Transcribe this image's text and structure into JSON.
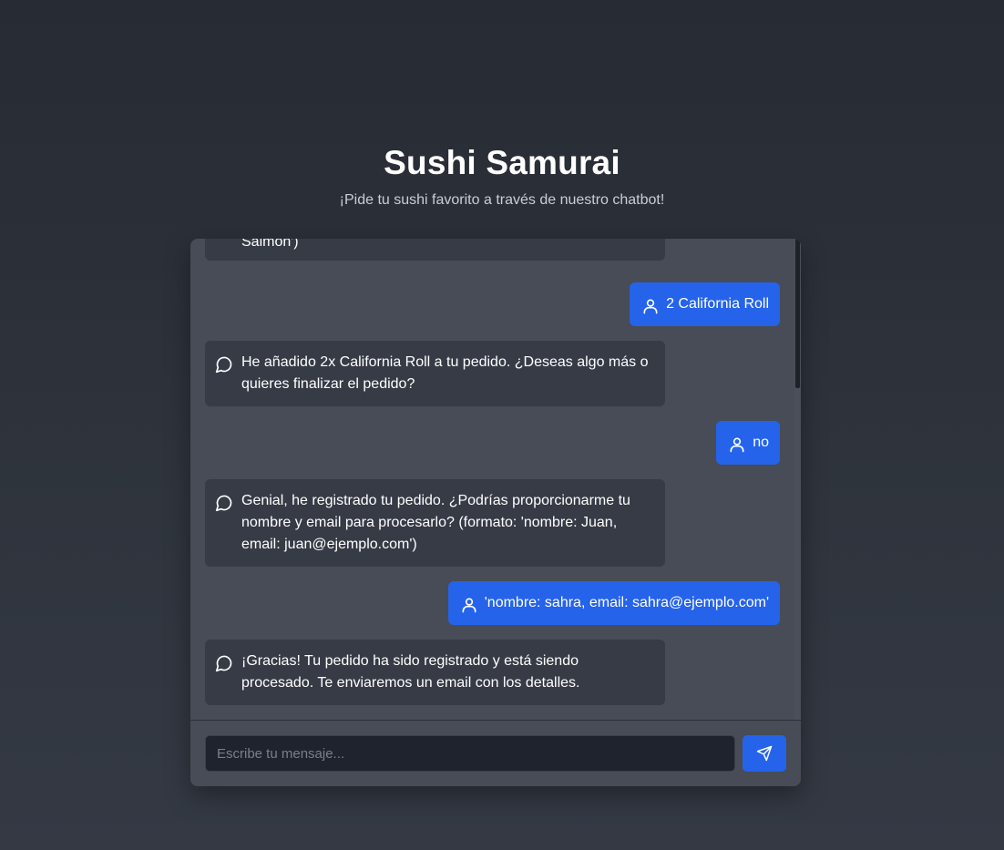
{
  "header": {
    "title": "Sushi Samurai",
    "subtitle": "¡Pide tu sushi favorito a través de nuestro chatbot!"
  },
  "colors": {
    "accent": "#2563eb",
    "bot_bubble": "#363b46",
    "chat_background": "#474c56",
    "page_background": "#2b2f37"
  },
  "messages": [
    {
      "role": "bot",
      "icon": "chat-bubble-icon",
      "text": "Salmón')"
    },
    {
      "role": "user",
      "icon": "user-icon",
      "text": "2 California Roll"
    },
    {
      "role": "bot",
      "icon": "chat-bubble-icon",
      "text": "He añadido 2x California Roll a tu pedido. ¿Deseas algo más o quieres finalizar el pedido?"
    },
    {
      "role": "user",
      "icon": "user-icon",
      "text": "no"
    },
    {
      "role": "bot",
      "icon": "chat-bubble-icon",
      "text": "Genial, he registrado tu pedido. ¿Podrías proporcionarme tu nombre y email para procesarlo? (formato: 'nombre: Juan, email: juan@ejemplo.com')"
    },
    {
      "role": "user",
      "icon": "user-icon",
      "text": "'nombre: sahra, email: sahra@ejemplo.com'"
    },
    {
      "role": "bot",
      "icon": "chat-bubble-icon",
      "text": "¡Gracias! Tu pedido ha sido registrado y está siendo procesado. Te enviaremos un email con los detalles."
    }
  ],
  "input": {
    "placeholder": "Escribe tu mensaje...",
    "value": ""
  },
  "send_button": {
    "icon": "send-icon"
  }
}
